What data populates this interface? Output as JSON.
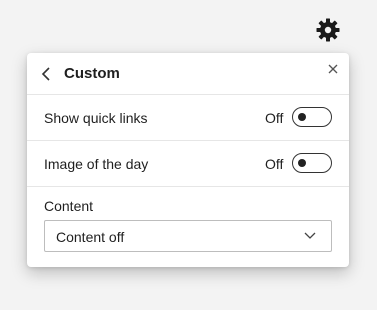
{
  "header": {
    "title": "Custom"
  },
  "settings": [
    {
      "label": "Show quick links",
      "state": "Off",
      "on": false
    },
    {
      "label": "Image of the day",
      "state": "Off",
      "on": false
    }
  ],
  "content": {
    "label": "Content",
    "selected": "Content off"
  },
  "icons": {
    "settings": "gear-icon",
    "back": "chevron-left-icon",
    "close": "close-icon",
    "dropdown": "chevron-down-icon"
  }
}
